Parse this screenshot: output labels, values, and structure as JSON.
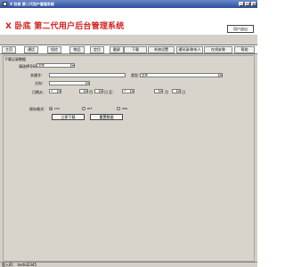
{
  "window": {
    "title": "X 卧底 第二代用户管理系统",
    "minimize": "_",
    "maximize": "□",
    "close": "×"
  },
  "header": {
    "logo_x": "X",
    "logo_text": "卧底 第二代用户后台管理系统",
    "logout_label": "用户退出"
  },
  "nav": {
    "tabs": [
      "主页",
      "通话",
      "短信",
      "物品",
      "定位",
      "截屏",
      "下载",
      "系统设置",
      "通讯录/联系人",
      "在线安装",
      "帮助"
    ]
  },
  "panel": {
    "title": "下载记录数据"
  },
  "form": {
    "phone_label": "请选择号码：",
    "phone_value": "全部",
    "keyword_label": "关键字：",
    "type_label": "类型：",
    "type_value": "全部",
    "direction_label": "方向：",
    "date_label": "日期从：",
    "date_from_day": "2",
    "date_from_month": "月",
    "date_from_year": "日",
    "to_label": "至：",
    "date_to_day": "2",
    "date_to_month": "月",
    "date_to_year": "日",
    "format_label": "保存格式：",
    "format_csv": "CSV",
    "format_rtf": "RTF",
    "format_xml": "XML",
    "download_btn": "立即下载",
    "reset_btn": "重置数据"
  },
  "status": {
    "text": "登入ID： testid2345"
  }
}
